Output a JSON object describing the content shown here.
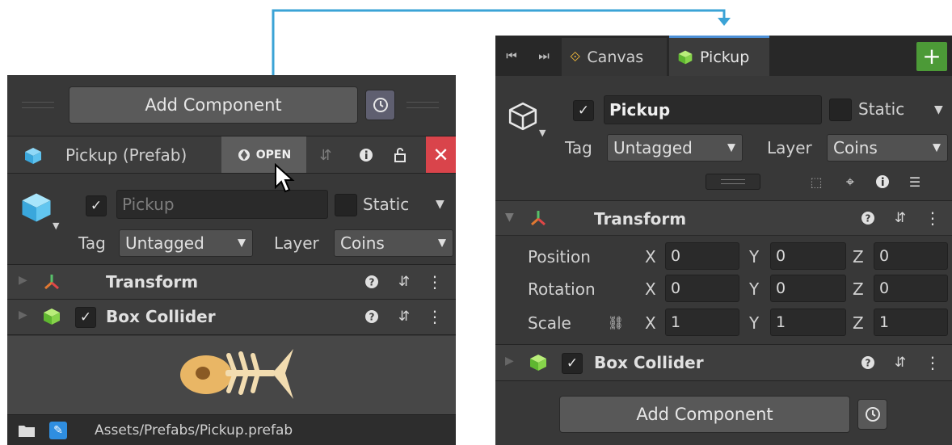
{
  "left_inspector": {
    "add_component_label": "Add Component",
    "header": {
      "title": "Pickup (Prefab)",
      "open_label": "OPEN"
    },
    "object": {
      "name": "Pickup",
      "static_label": "Static",
      "tag_label": "Tag",
      "tag_value": "Untagged",
      "layer_label": "Layer",
      "layer_value": "Coins"
    },
    "components": [
      {
        "name": "Transform"
      },
      {
        "name": "Box Collider"
      }
    ],
    "footer_path": "Assets/Prefabs/Pickup.prefab"
  },
  "right_inspector": {
    "tabs": [
      {
        "label": "Canvas"
      },
      {
        "label": "Pickup"
      }
    ],
    "object": {
      "name": "Pickup",
      "static_label": "Static",
      "tag_label": "Tag",
      "tag_value": "Untagged",
      "layer_label": "Layer",
      "layer_value": "Coins"
    },
    "transform": {
      "title": "Transform",
      "rows": [
        {
          "label": "Position",
          "x": "0",
          "y": "0",
          "z": "0"
        },
        {
          "label": "Rotation",
          "x": "0",
          "y": "0",
          "z": "0"
        },
        {
          "label": "Scale",
          "x": "1",
          "y": "1",
          "z": "1"
        }
      ],
      "axis_labels": {
        "x": "X",
        "y": "Y",
        "z": "Z"
      }
    },
    "box_collider": {
      "name": "Box Collider"
    },
    "add_component_label": "Add Component"
  },
  "colors": {
    "panel_bg": "#383838",
    "header_bg": "#3e3e3e",
    "accent_line": "#3ba3d6",
    "close_red": "#d9444b",
    "add_green": "#4c9a37",
    "open_bg": "#5d5d5d"
  }
}
